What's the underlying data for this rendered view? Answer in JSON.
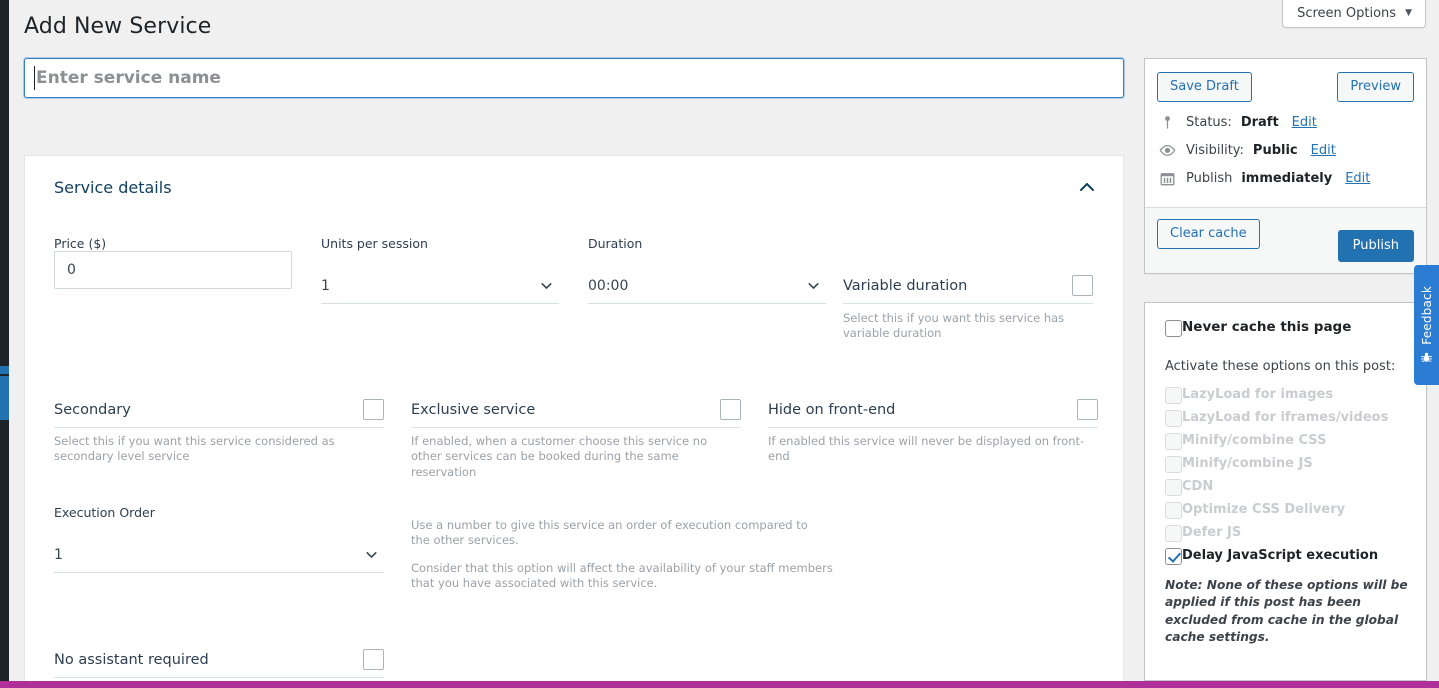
{
  "header": {
    "screen_options_label": "Screen Options",
    "screen_options_caret": "chevron-down-icon",
    "page_title": "Add New Service"
  },
  "title_field": {
    "value": "",
    "placeholder": "Enter service name"
  },
  "service_details": {
    "section_title": "Service details",
    "collapse_icon": "chevron-up-icon",
    "price": {
      "label": "Price ($)",
      "value": "0"
    },
    "units_per_session": {
      "label": "Units per session",
      "value": "1"
    },
    "duration": {
      "label": "Duration",
      "value": "00:00"
    },
    "variable_duration": {
      "label": "Variable duration",
      "help": "Select this if you want this service has variable duration",
      "checked": false
    },
    "secondary": {
      "label": "Secondary",
      "help": "Select this if you want this service considered as secondary level service",
      "checked": false
    },
    "exclusive_service": {
      "label": "Exclusive service",
      "help": "If enabled, when a customer choose this service no other services can be booked during the same reservation",
      "checked": false
    },
    "hide_on_frontend": {
      "label": "Hide on front-end",
      "help": "If enabled this service will never be displayed on front-end",
      "checked": false
    },
    "execution_order": {
      "label": "Execution Order",
      "value": "1",
      "help_1": "Use a number to give this service an order of execution compared to the other services.",
      "help_2": "Consider that this option will affect the availability of your staff members that you have associated with this service."
    },
    "no_assistant_required": {
      "label": "No assistant required",
      "checked": false
    }
  },
  "publish_box": {
    "save_draft_label": "Save Draft",
    "preview_label": "Preview",
    "status": {
      "icon": "pin-icon",
      "prefix": "Status:",
      "value": "Draft",
      "edit_label": "Edit"
    },
    "visibility": {
      "icon": "eye-icon",
      "prefix": "Visibility:",
      "value": "Public",
      "edit_label": "Edit"
    },
    "schedule": {
      "icon": "calendar-icon",
      "prefix": "Publish",
      "value": "immediately",
      "edit_label": "Edit"
    },
    "clear_cache_label": "Clear cache",
    "publish_label": "Publish"
  },
  "cache_box": {
    "never_cache_label": "Never cache this page",
    "never_cache_checked": false,
    "activate_label": "Activate these options on this post:",
    "options": [
      {
        "label": "LazyLoad for images",
        "checked": false,
        "disabled": true
      },
      {
        "label": "LazyLoad for iframes/videos",
        "checked": false,
        "disabled": true
      },
      {
        "label": "Minify/combine CSS",
        "checked": false,
        "disabled": true
      },
      {
        "label": "Minify/combine JS",
        "checked": false,
        "disabled": true
      },
      {
        "label": "CDN",
        "checked": false,
        "disabled": true
      },
      {
        "label": "Optimize CSS Delivery",
        "checked": false,
        "disabled": true
      },
      {
        "label": "Defer JS",
        "checked": false,
        "disabled": true
      },
      {
        "label": "Delay JavaScript execution",
        "checked": true,
        "disabled": false
      }
    ],
    "note": "Note: None of these options will be applied if this post has been excluded from cache in the global cache settings."
  },
  "feedback_tab": {
    "label": "Feedback",
    "icon": "bug-icon"
  },
  "colors": {
    "accent": "#2271b1",
    "admin_rail": "#1d2327",
    "bottom_bar": "#b0309a",
    "feedback": "#2b7cd3",
    "field_text": "#37474f"
  }
}
